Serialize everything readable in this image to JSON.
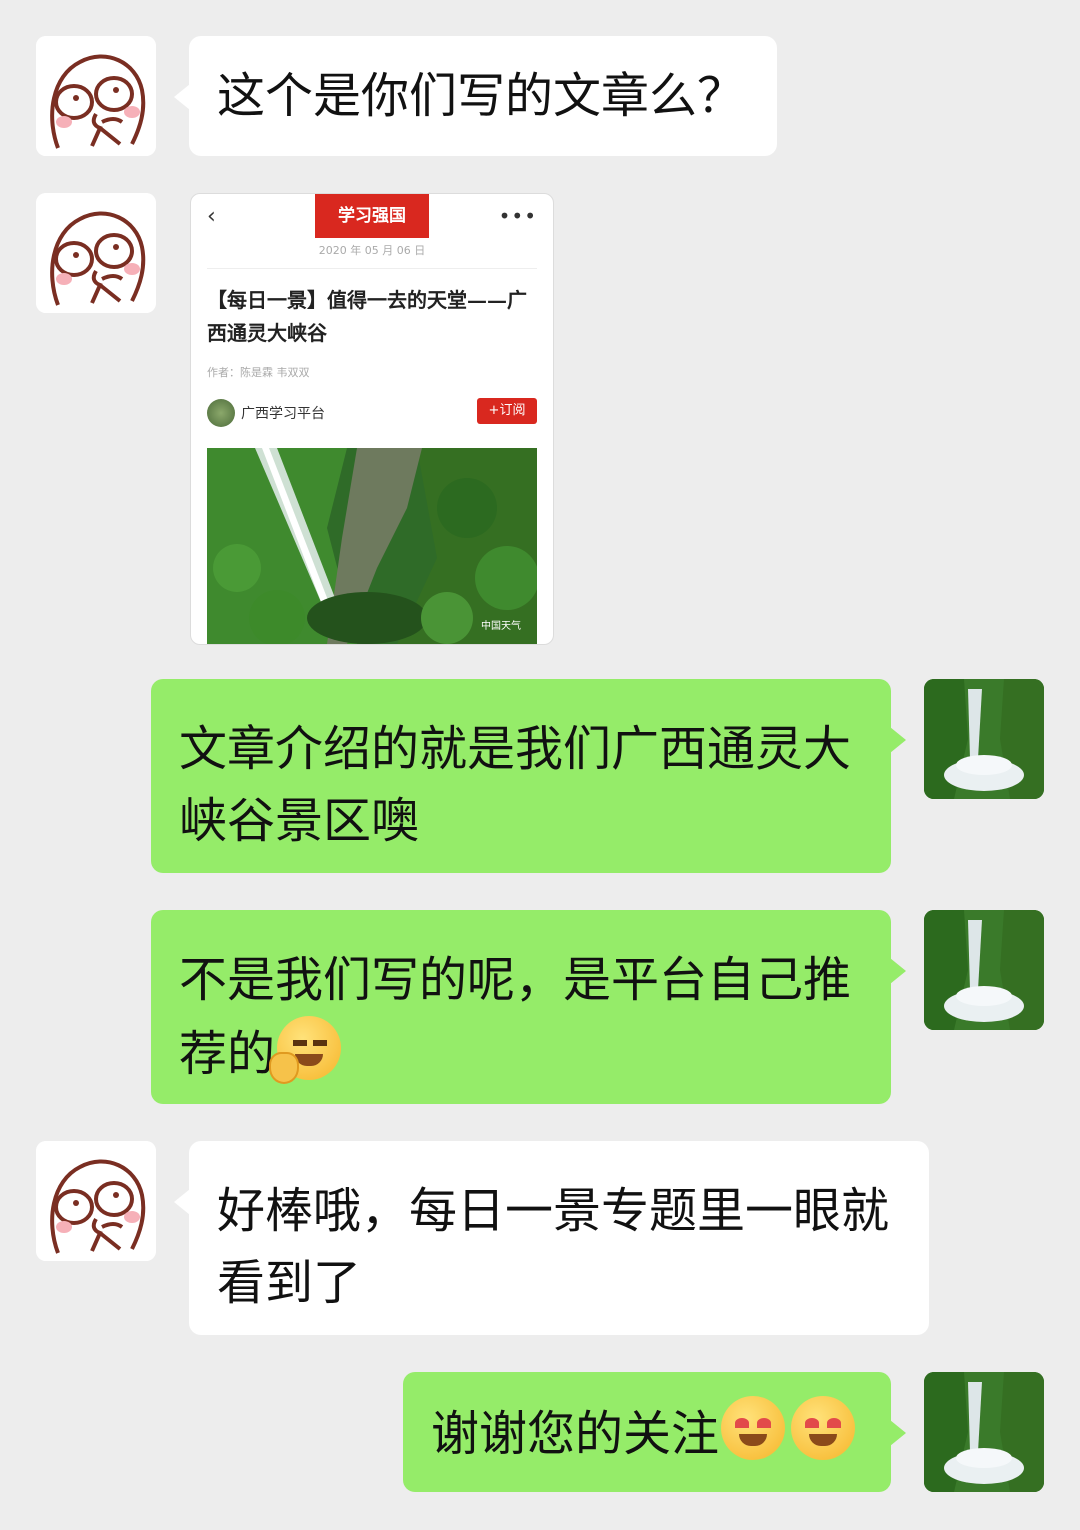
{
  "messages": [
    {
      "side": "left",
      "text": "这个是你们写的文章么？"
    },
    {
      "side": "left",
      "type": "article"
    },
    {
      "side": "right",
      "text": "文章介绍的就是我们广西通灵大峡谷景区噢"
    },
    {
      "side": "right",
      "text": "不是我们写的呢，是平台自己推荐的",
      "emoji": "peace-smile-emoji"
    },
    {
      "side": "left",
      "text": "好棒哦，每日一景专题里一眼就看到了"
    },
    {
      "side": "right",
      "text": "谢谢您的关注",
      "emoji": "heart-eyes-emoji"
    }
  ],
  "article": {
    "logo": "学习强国",
    "date": "2020 年 05 月 06 日",
    "title": "【每日一景】值得一去的天堂——广西通灵大峡谷",
    "author": "作者：陈是霖 韦双双",
    "source": "广西学习平台",
    "subscribe": "+订阅",
    "watermark": "中国天气",
    "back_icon": "chevron-left-icon",
    "more_icon": "more-icon"
  },
  "colors": {
    "background": "#ededed",
    "bubble_white": "#ffffff",
    "bubble_green": "#95ec69",
    "brand_red": "#d9281f"
  }
}
